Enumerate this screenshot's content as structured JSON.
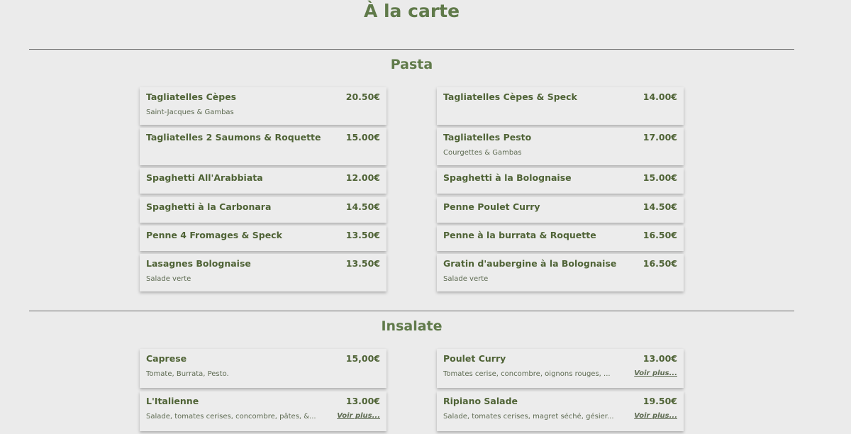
{
  "page_title": "À la carte",
  "sections": [
    {
      "title": "Pasta",
      "left_items": [
        {
          "name": "Tagliatelles Cèpes",
          "price": "20.50€",
          "desc": "Saint-Jacques & Gambas"
        },
        {
          "name": "Tagliatelles 2 Saumons & Roquette",
          "price": "15.00€"
        },
        {
          "name": "Spaghetti All'Arabbiata",
          "price": "12.00€"
        },
        {
          "name": "Spaghetti à la Carbonara",
          "price": "14.50€"
        },
        {
          "name": "Penne 4 Fromages & Speck",
          "price": "13.50€"
        },
        {
          "name": "Lasagnes Bolognaise",
          "price": "13.50€",
          "desc": "Salade verte"
        }
      ],
      "right_items": [
        {
          "name": "Tagliatelles Cèpes & Speck",
          "price": "14.00€"
        },
        {
          "name": "Tagliatelles Pesto",
          "price": "17.00€",
          "desc": "Courgettes & Gambas"
        },
        {
          "name": "Spaghetti à la Bolognaise",
          "price": "15.00€"
        },
        {
          "name": "Penne Poulet Curry",
          "price": "14.50€"
        },
        {
          "name": "Penne à la burrata & Roquette",
          "price": "16.50€"
        },
        {
          "name": "Gratin d'aubergine à la Bolognaise",
          "price": "16.50€",
          "desc": "Salade verte"
        }
      ]
    },
    {
      "title": "Insalate",
      "left_items": [
        {
          "name": "Caprese",
          "price": "15,00€",
          "desc": "Tomate, Burrata, Pesto."
        },
        {
          "name": "L'Italienne",
          "price": "13.00€",
          "desc": "Salade, tomates cerises, concombre, pâtes, &...",
          "more": "Voir plus..."
        }
      ],
      "right_items": [
        {
          "name": "Poulet Curry",
          "price": "13.00€",
          "desc": "Tomates cerise, concombre, oignons rouges, ...",
          "more": "Voir plus..."
        },
        {
          "name": "Ripiano Salade",
          "price": "19.50€",
          "desc": "Salade, tomates cerises, magret séché, gésier...",
          "more": "Voir plus..."
        }
      ]
    }
  ]
}
